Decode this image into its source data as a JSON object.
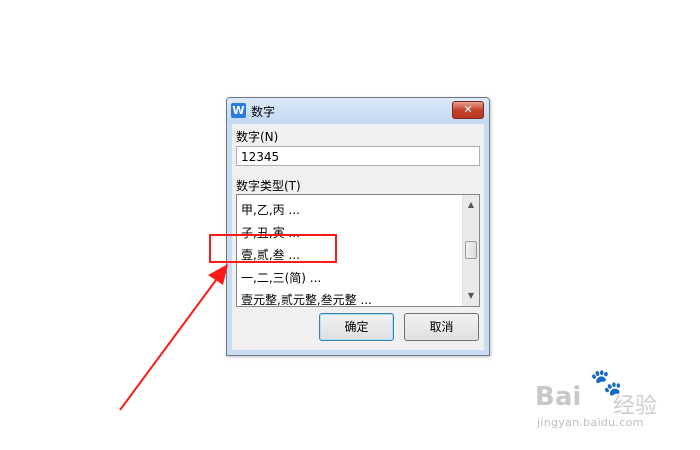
{
  "dialog": {
    "title": "数字",
    "app_icon_glyph": "W",
    "close_glyph": "✕"
  },
  "form": {
    "number_label": "数字(N)",
    "number_value": "12345",
    "type_label": "数字类型(T)",
    "types": [
      "甲,乙,丙 ...",
      "子,丑,寅 ...",
      "壹,贰,叁 ...",
      "一,二,三(简) ...",
      "壹元整,贰元整,叁元整 ..."
    ]
  },
  "buttons": {
    "ok": "确定",
    "cancel": "取消"
  },
  "scrollbar": {
    "up": "▲",
    "down": "▼"
  },
  "annotation": {
    "color": "#ff1a1a",
    "highlighted_item": "壹,贰,叁 ..."
  },
  "watermark": {
    "logo": "Bai",
    "paw": "🐾",
    "brand": "经验",
    "url": "jingyan.baidu.com"
  }
}
